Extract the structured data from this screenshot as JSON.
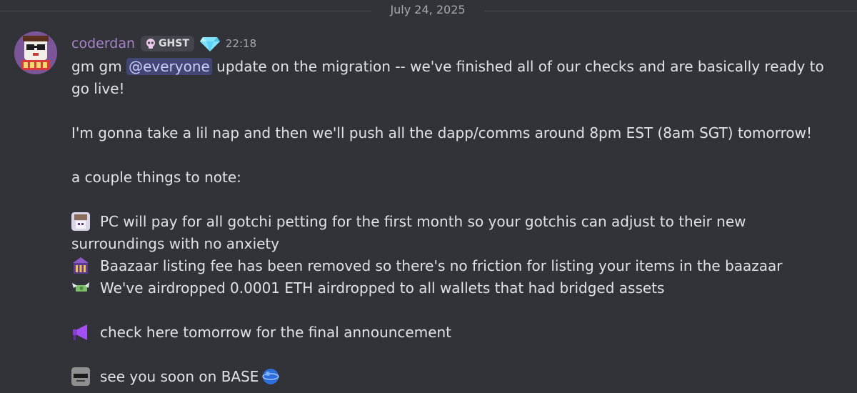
{
  "date_divider": "July 24, 2025",
  "message": {
    "username": "coderdan",
    "tag": "GHST",
    "timestamp": "22:18",
    "line1_before": "gm gm ",
    "mention": "@everyone",
    "line1_after": " update on the migration -- we've finished all of our checks and are basically ready to go live!",
    "line2": "I'm gonna take a lil nap and then we'll push all the dapp/comms around 8pm EST (8am SGT) tomorrow!",
    "line3": "a couple things to note:",
    "note1": "PC will pay for all gotchi petting for the first month so your gotchis can adjust to their new surroundings with no anxiety",
    "note2": "Baazaar listing fee has been removed so there's no friction for listing your items in the baazaar",
    "note3": "We've airdropped 0.0001 ETH airdropped to all wallets that had bridged assets",
    "line4": "check here tomorrow for the final announcement",
    "line5": "see you soon on BASE"
  },
  "icons": {
    "avatar": "gotchi-avatar",
    "tag_icon": "skull-icon",
    "badge": "diamond-icon",
    "note1_emoji": "gotchi-pet-emoji",
    "note2_emoji": "baazaar-emoji",
    "note3_emoji": "money-wings-emoji",
    "announce_emoji": "megaphone-emoji",
    "sunglasses_emoji": "cool-face-emoji",
    "base_emoji": "blue-globe-emoji"
  },
  "colors": {
    "background": "#323339",
    "username": "#a784c8",
    "mention_bg": "#414675",
    "mention_text": "#c9cdfb"
  }
}
